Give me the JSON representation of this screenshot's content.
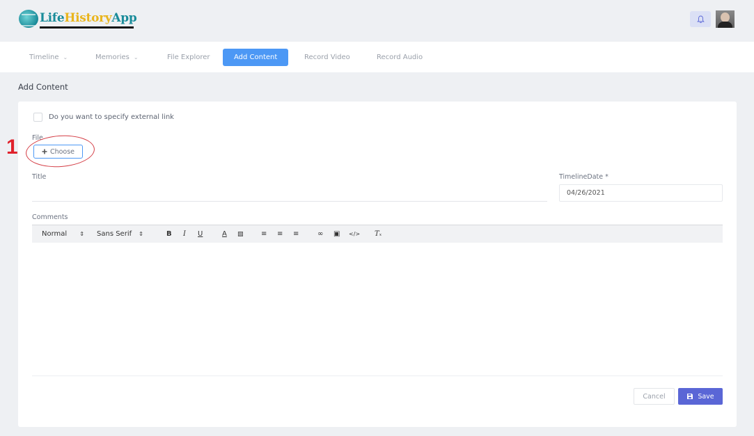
{
  "app": {
    "logo_parts": [
      "Life",
      "History",
      "App"
    ]
  },
  "nav": {
    "items": [
      {
        "label": "Timeline",
        "has_dropdown": true
      },
      {
        "label": "Memories",
        "has_dropdown": true
      },
      {
        "label": "File Explorer",
        "has_dropdown": false
      },
      {
        "label": "Add Content",
        "has_dropdown": false,
        "active": true
      },
      {
        "label": "Record Video",
        "has_dropdown": false
      },
      {
        "label": "Record Audio",
        "has_dropdown": false
      }
    ]
  },
  "page": {
    "title": "Add Content"
  },
  "form": {
    "external_link_label": "Do you want to specify external link",
    "external_link_checked": false,
    "file_label": "File",
    "choose_label": "Choose",
    "title_label": "Title",
    "title_value": "",
    "date_label": "TimelineDate *",
    "date_value": "04/26/2021",
    "comments_label": "Comments",
    "editor": {
      "header_select": "Normal",
      "font_select": "Sans Serif"
    },
    "cancel_label": "Cancel",
    "save_label": "Save"
  },
  "annotation": {
    "number": "1",
    "color": "#e0222c"
  },
  "colors": {
    "accent": "#4c98f5",
    "save": "#5a66d6"
  },
  "icons": [
    "bell-icon",
    "plus-icon",
    "bold-icon",
    "italic-icon",
    "underline-icon",
    "font-color-icon",
    "background-color-icon",
    "ordered-list-icon",
    "bullet-list-icon",
    "align-icon",
    "link-icon",
    "image-icon",
    "code-icon",
    "clear-format-icon",
    "save-icon"
  ]
}
